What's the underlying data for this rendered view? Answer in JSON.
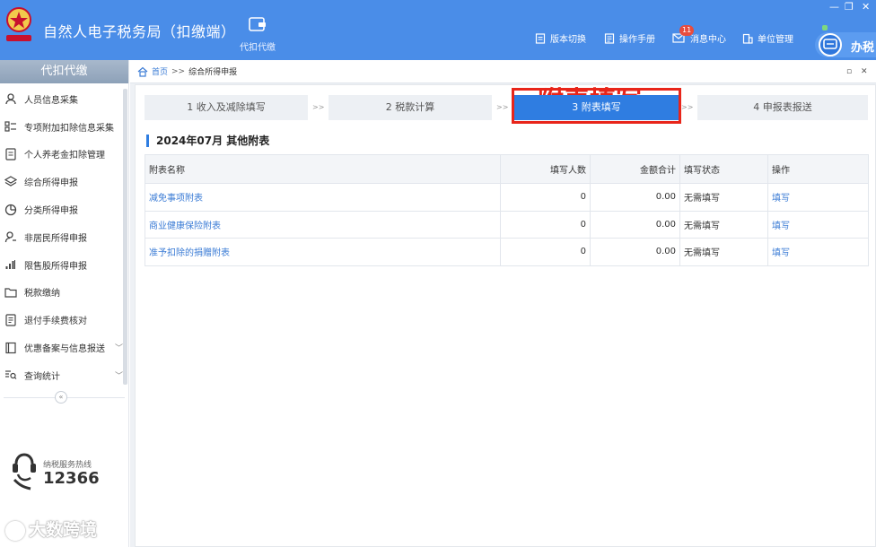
{
  "app": {
    "title": "自然人电子税务局（扣缴端）"
  },
  "header": {
    "nav": {
      "label": "代扣代缴"
    },
    "items": [
      {
        "label": "版本切换",
        "icon": "document-icon"
      },
      {
        "label": "操作手册",
        "icon": "manual-icon"
      },
      {
        "label": "消息中心",
        "icon": "mail-icon",
        "badge": "11"
      },
      {
        "label": "单位管理",
        "icon": "building-icon"
      }
    ],
    "office_label": "办税"
  },
  "sidebar": {
    "title": "代扣代缴",
    "items": [
      {
        "label": "人员信息采集",
        "icon": "person-icon"
      },
      {
        "label": "专项附加扣除信息采集",
        "icon": "list-icon"
      },
      {
        "label": "个人养老金扣除管理",
        "icon": "card-icon"
      },
      {
        "label": "综合所得申报",
        "icon": "layers-icon"
      },
      {
        "label": "分类所得申报",
        "icon": "pie-icon"
      },
      {
        "label": "非居民所得申报",
        "icon": "user-icon"
      },
      {
        "label": "限售股所得申报",
        "icon": "bar-chart-icon"
      },
      {
        "label": "税款缴纳",
        "icon": "folder-icon"
      },
      {
        "label": "退付手续费核对",
        "icon": "receipt-icon"
      },
      {
        "label": "优惠备案与信息报送",
        "icon": "book-icon",
        "expandable": true
      },
      {
        "label": "查询统计",
        "icon": "search-list-icon",
        "expandable": true
      }
    ],
    "hotline": {
      "label": "纳税服务热线",
      "number": "12366"
    }
  },
  "breadcrumb": {
    "home": "首页",
    "separator": ">>",
    "current": "综合所得申报"
  },
  "steps": [
    {
      "label": "1 收入及减除填写"
    },
    {
      "label": "2 税款计算"
    },
    {
      "label": "3 附表填写",
      "active": true
    },
    {
      "label": "4 申报表报送"
    }
  ],
  "step_separator": ">>",
  "annotation": "附表填写",
  "section_title": "2024年07月  其他附表",
  "table": {
    "headers": [
      "附表名称",
      "填写人数",
      "金额合计",
      "填写状态",
      "操作"
    ],
    "rows": [
      {
        "name": "减免事项附表",
        "count": "0",
        "amount": "0.00",
        "status": "无需填写",
        "action": "填写"
      },
      {
        "name": "商业健康保险附表",
        "count": "0",
        "amount": "0.00",
        "status": "无需填写",
        "action": "填写"
      },
      {
        "name": "准予扣除的捐赠附表",
        "count": "0",
        "amount": "0.00",
        "status": "无需填写",
        "action": "填写"
      }
    ]
  },
  "watermark": "大数跨境",
  "colors": {
    "header": "#4a8de8",
    "active_step": "#2f7de1",
    "annotation": "#e8251a",
    "link": "#3a7bd5"
  }
}
